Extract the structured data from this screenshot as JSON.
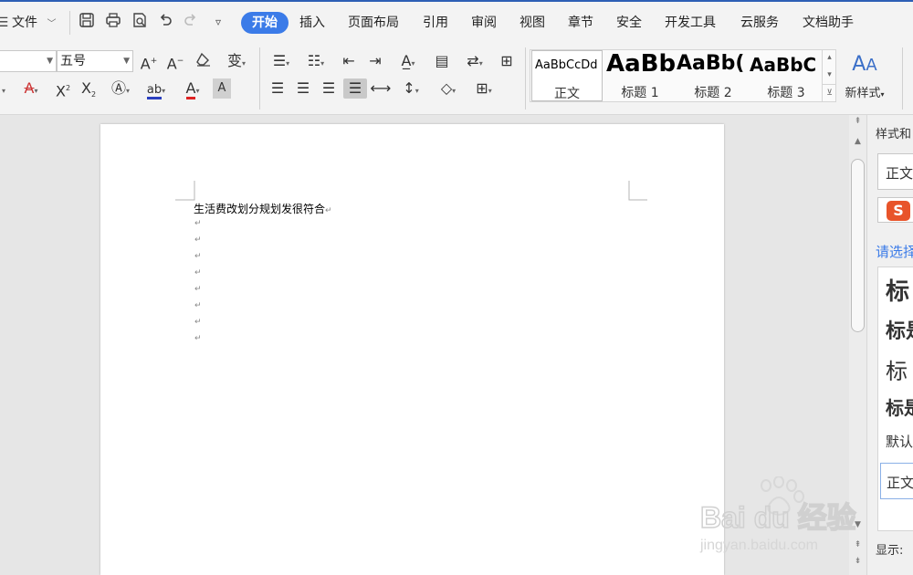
{
  "menubar": {
    "file_label": "文件",
    "tabs": [
      "开始",
      "插入",
      "页面布局",
      "引用",
      "审阅",
      "视图",
      "章节",
      "安全",
      "开发工具",
      "云服务",
      "文档助手"
    ]
  },
  "ribbon": {
    "font_size_value": "五号",
    "styles": [
      {
        "sample": "AaBbCcDd",
        "label": "正文"
      },
      {
        "sample": "AaBb",
        "label": "标题 1"
      },
      {
        "sample": "AaBb(",
        "label": "标题 2"
      },
      {
        "sample": "AaBbC",
        "label": "标题 3"
      }
    ],
    "new_style_label": "新样式"
  },
  "document": {
    "first_line": "生活费改划分规划发很符合",
    "paragraph_mark": "↵"
  },
  "side_panel": {
    "title": "样式和",
    "current_style": "正文",
    "prompt": "请选择",
    "style_list": [
      "标",
      "标是",
      "标",
      "标是",
      "默认",
      "正文"
    ],
    "show_label": "显示:"
  },
  "watermark": {
    "brand": "Bai du 经验",
    "url": "jingyan.baidu.com"
  },
  "colors": {
    "accent": "#3b7be8",
    "link": "#3b7be8"
  }
}
